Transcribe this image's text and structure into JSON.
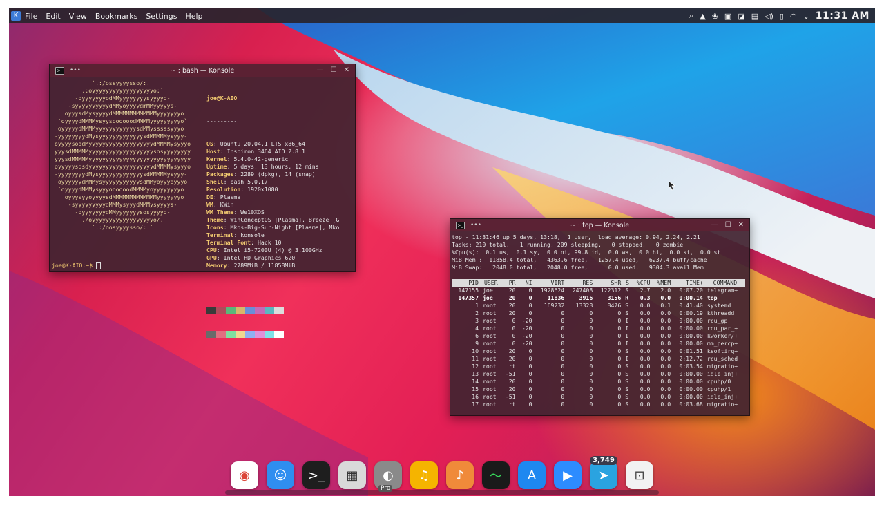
{
  "menubar": {
    "menus": [
      "File",
      "Edit",
      "View",
      "Bookmarks",
      "Settings",
      "Help"
    ],
    "clock": "11:31 AM"
  },
  "neofetch_window": {
    "title": "~ : bash — Konsole",
    "art": [
      "            `.:/ossyyyysso/:.",
      "         .:oyyyyyyyyyyyyyyyyyyo:`",
      "       -oyyyyyyyodMMyyyyyyyysyyyyo-",
      "     -syyyyyyyyyydMMyoyyyydmMMyyyyys-",
      "    oyyysdMysyyyydMMMMMMMMMMMMMyyyyyyyo",
      "  `oyyyydMMMMysyysoooooodMMMMyyyyyyyyyo`",
      "  oyyyyydMMMMyyyyyyyyyyyysdMMysssssyyyo",
      " -yyyyyyyydMysyyyyyyyyyyyyysdMMMMMysyyy-",
      " oyyyysoodMyyyyyyyyyyyyyyyyyyydMMMMysyyyo",
      " yyysdMMMMMyyyyyyyyyyyyyyyyyyysosyyyyyyyy",
      " yyysdMMMMMyyyyyyyyyyyyyyyyyyyyyyyyyyyyyy",
      " oyyyyysosdyyyyyyyyyyyyyyyyyyydMMMMysyyyo",
      " -yyyyyyyydMysyyyyyyyyyyyyysdMMMMMysyyy-",
      "  oyyyyyydMMMysyyyyyyyyyyysdMMyoyyyoyyyo",
      "  `oyyyydMMMysyyyoooooodMMMMyoyyyyyyyyo",
      "    oyyysyyoyyyysdMMMMMMMMMMMMMyyyyyyyo",
      "     -syyyyyyyyydMMMysyyydMMMysyyyys-",
      "       -oyyyyyyydMMyyyyyyysosyyyyo-",
      "         ./oyyyyyyyyyyyyyyyyyyo/.",
      "            `.:/oosyyyysso/:.`"
    ],
    "user_host": "joe@K-AIO",
    "separator": "---------",
    "info": [
      {
        "label": "OS",
        "value": "Ubuntu 20.04.1 LTS x86_64"
      },
      {
        "label": "Host",
        "value": "Inspiron 3464 AIO 2.8.1"
      },
      {
        "label": "Kernel",
        "value": "5.4.0-42-generic"
      },
      {
        "label": "Uptime",
        "value": "5 days, 13 hours, 12 mins"
      },
      {
        "label": "Packages",
        "value": "2289 (dpkg), 14 (snap)"
      },
      {
        "label": "Shell",
        "value": "bash 5.0.17"
      },
      {
        "label": "Resolution",
        "value": "1920x1080"
      },
      {
        "label": "DE",
        "value": "Plasma"
      },
      {
        "label": "WM",
        "value": "KWin"
      },
      {
        "label": "WM Theme",
        "value": "We10XOS"
      },
      {
        "label": "Theme",
        "value": "WinConceptOS [Plasma], Breeze [G"
      },
      {
        "label": "Icons",
        "value": "Mkos-Big-Sur-Night [Plasma], Mko"
      },
      {
        "label": "Terminal",
        "value": "konsole"
      },
      {
        "label": "Terminal Font",
        "value": "Hack 10"
      },
      {
        "label": "CPU",
        "value": "Intel i5-7200U (4) @ 3.100GHz"
      },
      {
        "label": "GPU",
        "value": "Intel HD Graphics 620"
      },
      {
        "label": "Memory",
        "value": "2789MiB / 11858MiB"
      }
    ],
    "swatches_top": [
      "#3a3a3a",
      "#b04a5a",
      "#5ab87a",
      "#d8b66a",
      "#6a8ed8",
      "#c46ab8",
      "#5ab8c0",
      "#dcdcdc"
    ],
    "swatches_bottom": [
      "#6a6a6a",
      "#e07080",
      "#80e0a0",
      "#f0d890",
      "#90b0f0",
      "#e090d8",
      "#80e0e8",
      "#ffffff"
    ],
    "prompt": "joe@K-AIO:~$"
  },
  "top_window": {
    "title": "~ : top — Konsole",
    "header": [
      "top - 11:31:46 up 5 days, 13:18,  1 user,  load average: 0.94, 2.24, 2.21",
      "Tasks: 210 total,   1 running, 209 sleeping,   0 stopped,   0 zombie",
      "%Cpu(s):  0.1 us,  0.1 sy,  0.0 ni, 99.8 id,  0.0 wa,  0.0 hi,  0.0 si,  0.0 st",
      "MiB Mem :  11858.4 total,   4363.6 free,   1257.4 used,   6237.4 buff/cache",
      "MiB Swap:   2048.0 total,   2048.0 free,      0.0 used.   9304.3 avail Mem"
    ],
    "columns": [
      "PID",
      "USER",
      "PR",
      "NI",
      "VIRT",
      "RES",
      "SHR",
      "S",
      "%CPU",
      "%MEM",
      "TIME+",
      "COMMAND"
    ],
    "rows": [
      [
        "147155",
        "joe",
        "20",
        "0",
        "1928624",
        "247408",
        "122312",
        "S",
        "2.7",
        "2.0",
        "0:07.20",
        "telegram+"
      ],
      [
        "147357",
        "joe",
        "20",
        "0",
        "11836",
        "3916",
        "3156",
        "R",
        "0.3",
        "0.0",
        "0:00.14",
        "top"
      ],
      [
        "1",
        "root",
        "20",
        "0",
        "169232",
        "13328",
        "8476",
        "S",
        "0.0",
        "0.1",
        "0:41.40",
        "systemd"
      ],
      [
        "2",
        "root",
        "20",
        "0",
        "0",
        "0",
        "0",
        "S",
        "0.0",
        "0.0",
        "0:00.19",
        "kthreadd"
      ],
      [
        "3",
        "root",
        "0",
        "-20",
        "0",
        "0",
        "0",
        "I",
        "0.0",
        "0.0",
        "0:00.00",
        "rcu_gp"
      ],
      [
        "4",
        "root",
        "0",
        "-20",
        "0",
        "0",
        "0",
        "I",
        "0.0",
        "0.0",
        "0:00.00",
        "rcu_par_+"
      ],
      [
        "6",
        "root",
        "0",
        "-20",
        "0",
        "0",
        "0",
        "I",
        "0.0",
        "0.0",
        "0:00.00",
        "kworker/+"
      ],
      [
        "9",
        "root",
        "0",
        "-20",
        "0",
        "0",
        "0",
        "I",
        "0.0",
        "0.0",
        "0:00.00",
        "mm_percp+"
      ],
      [
        "10",
        "root",
        "20",
        "0",
        "0",
        "0",
        "0",
        "S",
        "0.0",
        "0.0",
        "0:01.51",
        "ksoftirq+"
      ],
      [
        "11",
        "root",
        "20",
        "0",
        "0",
        "0",
        "0",
        "I",
        "0.0",
        "0.0",
        "2:12.72",
        "rcu_sched"
      ],
      [
        "12",
        "root",
        "rt",
        "0",
        "0",
        "0",
        "0",
        "S",
        "0.0",
        "0.0",
        "0:03.54",
        "migratio+"
      ],
      [
        "13",
        "root",
        "-51",
        "0",
        "0",
        "0",
        "0",
        "S",
        "0.0",
        "0.0",
        "0:00.00",
        "idle_inj+"
      ],
      [
        "14",
        "root",
        "20",
        "0",
        "0",
        "0",
        "0",
        "S",
        "0.0",
        "0.0",
        "0:00.00",
        "cpuhp/0"
      ],
      [
        "15",
        "root",
        "20",
        "0",
        "0",
        "0",
        "0",
        "S",
        "0.0",
        "0.0",
        "0:00.00",
        "cpuhp/1"
      ],
      [
        "16",
        "root",
        "-51",
        "0",
        "0",
        "0",
        "0",
        "S",
        "0.0",
        "0.0",
        "0:00.00",
        "idle_inj+"
      ],
      [
        "17",
        "root",
        "rt",
        "0",
        "0",
        "0",
        "0",
        "S",
        "0.0",
        "0.0",
        "0:03.68",
        "migratio+"
      ]
    ]
  },
  "dock": {
    "apps": [
      {
        "name": "chrome-icon",
        "glyph": "◉",
        "bg": "#ffffff",
        "fg": "#db4437"
      },
      {
        "name": "finder-icon",
        "glyph": "☺",
        "bg": "#2f8ef0",
        "fg": "#ffffff"
      },
      {
        "name": "terminal-icon",
        "glyph": ">_",
        "bg": "#1e1e1e",
        "fg": "#ffffff"
      },
      {
        "name": "calculator-icon",
        "glyph": "▦",
        "bg": "#d9d9d9",
        "fg": "#333333"
      },
      {
        "name": "earth-pro-icon",
        "glyph": "◐",
        "bg": "#8a8a8a",
        "fg": "#ffffff",
        "label": "Pro"
      },
      {
        "name": "music-player-icon",
        "glyph": "♫",
        "bg": "#f5b400",
        "fg": "#ffffff"
      },
      {
        "name": "music-icon",
        "glyph": "♪",
        "bg": "#f08a3a",
        "fg": "#ffffff"
      },
      {
        "name": "activity-monitor-icon",
        "glyph": "〜",
        "bg": "#1a1a1a",
        "fg": "#37d65a"
      },
      {
        "name": "app-store-icon",
        "glyph": "A",
        "bg": "#1e88f0",
        "fg": "#ffffff"
      },
      {
        "name": "zoom-icon",
        "glyph": "▶",
        "bg": "#2d8cff",
        "fg": "#ffffff"
      },
      {
        "name": "telegram-icon",
        "glyph": "➤",
        "bg": "#2aa3e0",
        "fg": "#ffffff",
        "badge": "3,749"
      },
      {
        "name": "screenshot-icon",
        "glyph": "⊡",
        "bg": "#f2f2f2",
        "fg": "#444444"
      }
    ]
  }
}
